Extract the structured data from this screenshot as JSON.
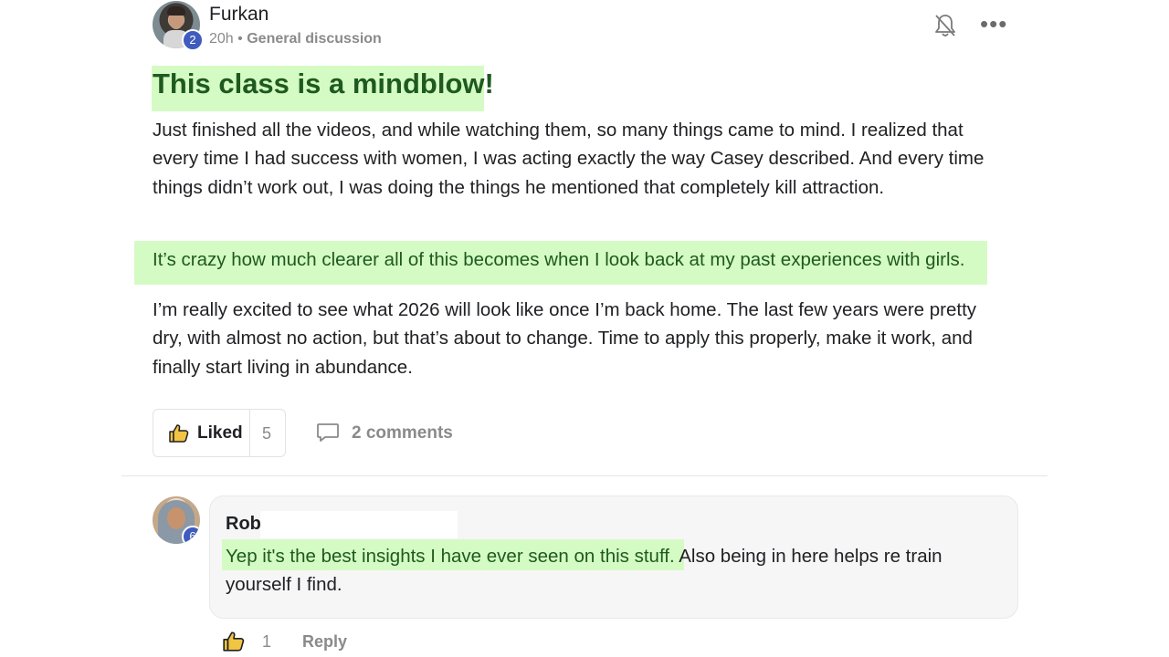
{
  "post": {
    "author": "Furkan",
    "author_level": "2",
    "time": "20h",
    "separator": "•",
    "category": "General discussion",
    "title": "This class is a mindblow!",
    "paragraph1": "Just finished all the videos, and while watching them, so many things came to mind. I realized that every time I had success with women, I was acting exactly the way Casey described. And every time things didn’t work out, I was doing the things he mentioned that completely kill attraction.",
    "highlight": "It’s crazy how much clearer all of this becomes when I look back at my past experiences with girls.",
    "paragraph2": "I’m really excited to see what 2026 will look like once I’m back home. The last few years were pretty dry, with almost no action, but that’s about to change. Time to apply this properly, make it work, and finally start living in abundance.",
    "like_label": "Liked",
    "like_count": "5",
    "comments_label": "2 comments",
    "more_label": "•••"
  },
  "comment": {
    "author": "Rob",
    "author_level": "6",
    "highlight_text": "Yep it's the best insights I have ever seen on this stuff.",
    "rest_text": " Also being in here helps re train yourself I find.",
    "like_count": "1",
    "reply_label": "Reply"
  },
  "colors": {
    "highlight_bg": "#d5fbc4",
    "highlight_text": "#1e5a1f",
    "badge": "#3e5bbd",
    "like_icon": "#f2c443"
  },
  "icons": {
    "bell": "bell-off-icon",
    "more": "more-horizontal-icon",
    "thumb": "thumbs-up-icon",
    "comment": "comment-bubble-icon"
  }
}
